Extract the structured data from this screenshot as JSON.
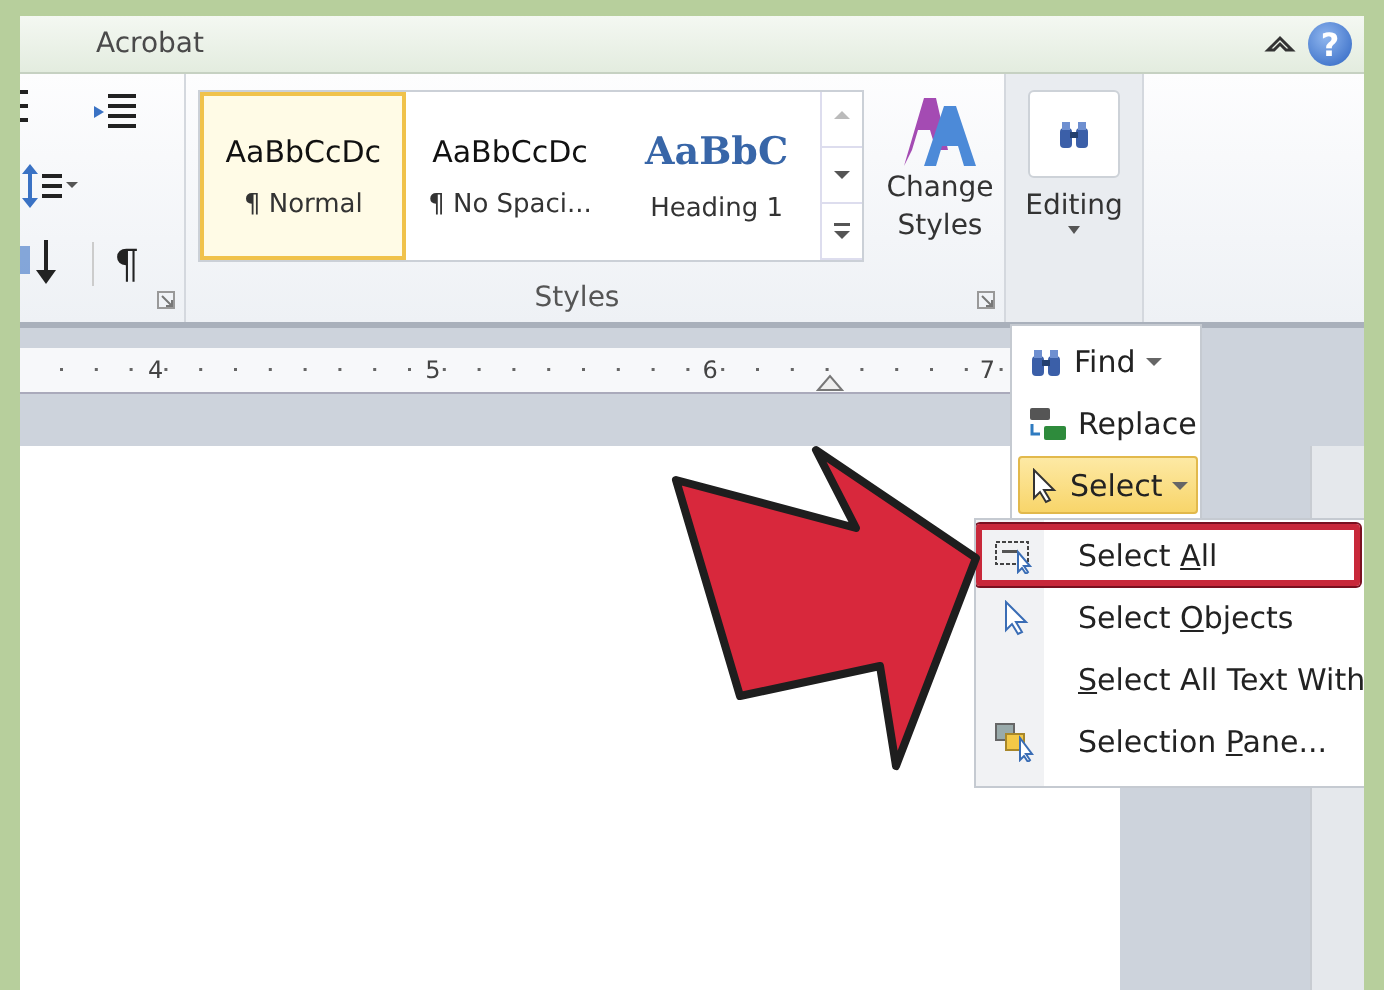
{
  "title_bar": {
    "tab": "Acrobat",
    "help_glyph": "?"
  },
  "paragraph_group": {
    "mark_glyph": "¶"
  },
  "styles_group": {
    "label": "Styles",
    "items": [
      {
        "preview": "AaBbCcDc",
        "label": "¶ Normal",
        "kind": "body",
        "selected": true
      },
      {
        "preview": "AaBbCcDc",
        "label": "¶ No Spaci...",
        "kind": "body",
        "selected": false
      },
      {
        "preview": "AaBbC",
        "label": "Heading 1",
        "kind": "heading",
        "selected": false
      }
    ],
    "change_styles": "Change Styles"
  },
  "editing_group": {
    "label": "Editing"
  },
  "ruler": {
    "numbers": [
      "4",
      "5",
      "6",
      "7"
    ]
  },
  "editing_menu": [
    {
      "kind": "find",
      "label": "Find",
      "dropdown": true,
      "selected": false
    },
    {
      "kind": "replace",
      "label": "Replace",
      "dropdown": false,
      "selected": false
    },
    {
      "kind": "select",
      "label": "Select",
      "dropdown": true,
      "selected": true
    }
  ],
  "select_menu": [
    {
      "kind": "select-all",
      "before": "Select ",
      "key": "A",
      "after": "ll",
      "highlighted": true
    },
    {
      "kind": "objects",
      "before": "Select ",
      "key": "O",
      "after": "bjects",
      "highlighted": false
    },
    {
      "kind": "none",
      "key": "S",
      "after": "elect All Text With",
      "highlighted": false
    },
    {
      "kind": "pane",
      "before": "Selection ",
      "key": "P",
      "after": "ane...",
      "highlighted": false
    }
  ]
}
